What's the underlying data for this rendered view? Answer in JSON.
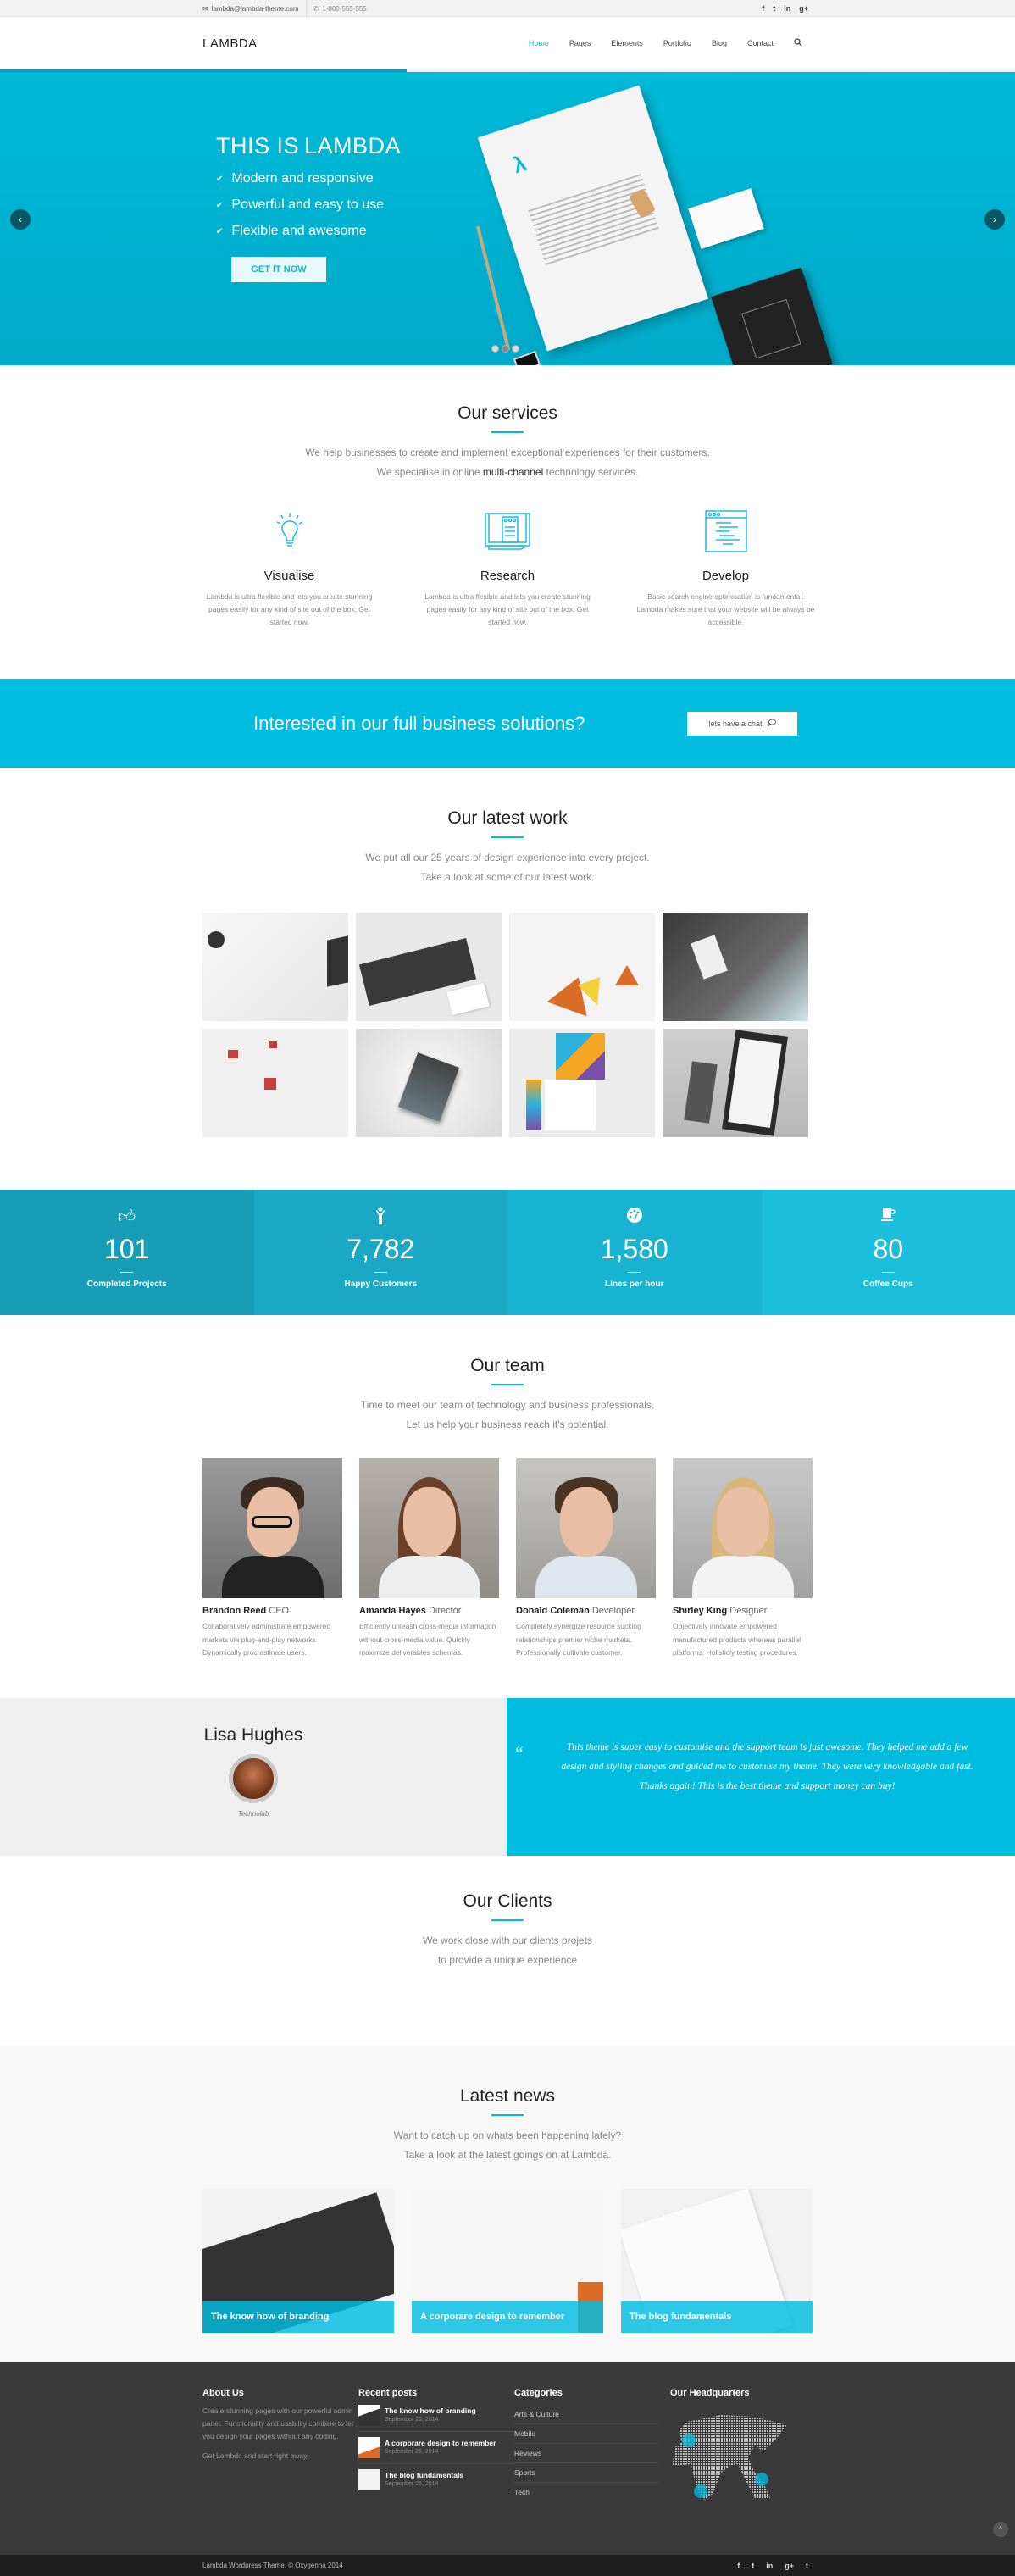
{
  "topbar": {
    "email": "lambda@lambda-theme.com",
    "phone": "1-800-555-555",
    "social": [
      "f",
      "t",
      "in",
      "g+"
    ]
  },
  "header": {
    "logo": "LAMBDA",
    "nav": [
      "Home",
      "Pages",
      "Elements",
      "Portfolio",
      "Blog",
      "Contact"
    ],
    "active_nav": "Home"
  },
  "hero": {
    "title_light": "THIS IS",
    "title_bold": "LAMBDA",
    "features": [
      "Modern and responsive",
      "Powerful and easy to use",
      "Flexible and awesome"
    ],
    "button": "GET IT NOW",
    "slides": 3,
    "active_slide": 2
  },
  "services": {
    "title": "Our services",
    "sub1": "We help businesses to create and implement exceptional experiences for their customers.",
    "sub2_pre": "We specialise in online ",
    "sub2_bold": "multi-channel",
    "sub2_post": " technology services.",
    "items": [
      {
        "icon": "lightbulb-icon",
        "title": "Visualise",
        "text": "Lambda is ultra flexible and lets you create stunning pages easily for any kind of site out of the box. Get started now."
      },
      {
        "icon": "book-notes-icon",
        "title": "Research",
        "text": "Lambda is ultra flexible and lets you create stunning pages easily for any kind of site out of the box. Get started now."
      },
      {
        "icon": "code-window-icon",
        "title": "Develop",
        "text": "Basic search engine optimisation is fundamental. Lambda makes sure that your website will be always be accessible."
      }
    ]
  },
  "cta": {
    "text": "Interested in our full business solutions?",
    "button": "lets have a chat"
  },
  "work": {
    "title": "Our latest work",
    "sub1": "We put all our 25 years of design experience into every project.",
    "sub2": "Take a look at some of our latest work."
  },
  "stats": [
    {
      "icon": "thumbs-up-icon",
      "value": "101",
      "label": "Completed Projects",
      "color": "#179db5"
    },
    {
      "icon": "person-icon",
      "value": "7,782",
      "label": "Happy Customers",
      "color": "#19a9c4"
    },
    {
      "icon": "dashboard-icon",
      "value": "1,580",
      "label": "Lines per hour",
      "color": "#17b3d0"
    },
    {
      "icon": "coffee-cup-icon",
      "value": "80",
      "label": "Coffee Cups",
      "color": "#1bbfdb"
    }
  ],
  "team": {
    "title": "Our team",
    "sub1": "Time to meet our team of technology and business professionals.",
    "sub2": "Let us help your business reach it's potential.",
    "members": [
      {
        "name": "Brandon Reed",
        "role": "CEO",
        "bio": "Collaboratively administrate empowered markets via plug-and-play networks. Dynamically procrastinate users."
      },
      {
        "name": "Amanda Hayes",
        "role": "Director",
        "bio": "Efficiently unleash cross-media information without cross-media value. Quickly maximize deliverables schemas."
      },
      {
        "name": "Donald Coleman",
        "role": "Developer",
        "bio": "Completely synergize resource sucking relationships premier niche markets. Professionally cultivate customer."
      },
      {
        "name": "Shirley King",
        "role": "Designer",
        "bio": "Objectively innovate empowered manufactured products whereas parallel platforms. Holisticly testing procedures."
      }
    ]
  },
  "testimonial": {
    "name": "Lisa Hughes",
    "company": "Technolab",
    "quote": "This theme is super easy to customise and the support team is just awesome. They helped me add a few design and styling changes and guided me to customise my theme. They were very knowledgable and fast. Thanks again! This is the best theme and support money can buy!"
  },
  "clients": {
    "title": "Our Clients",
    "sub1": "We work close with our clients projets",
    "sub2": "to provide a unique experience"
  },
  "news": {
    "title": "Latest news",
    "sub1": "Want to catch up on whats been happening lately?",
    "sub2": "Take a look at the latest goings on at Lambda.",
    "posts": [
      "The know how of branding",
      "A corporare design to remember",
      "The blog fundamentals"
    ]
  },
  "footer": {
    "about_title": "About Us",
    "about_text": "Create stunning pages with our powerful admin panel. Functionality and usability combine to let you design your pages without any coding.",
    "about_text2": "Get Lambda and start right away.",
    "recent_title": "Recent posts",
    "recent": [
      {
        "title": "The know how of branding",
        "date": "September 25, 2014"
      },
      {
        "title": "A corporare design to remember",
        "date": "September 25, 2014"
      },
      {
        "title": "The blog fundamentals",
        "date": "September 25, 2014"
      }
    ],
    "categories_title": "Categories",
    "categories": [
      "Arts & Culture",
      "Mobile",
      "Reviews",
      "Sports",
      "Tech"
    ],
    "hq_title": "Our Headquarters",
    "copyright": "Lambda Wordpress Theme. © Oxygenna 2014",
    "social": [
      "f",
      "t",
      "in",
      "g+",
      "t"
    ]
  },
  "colors": {
    "accent": "#00bde0",
    "footer": "#3a3a3a",
    "bottombar": "#1e1e1e"
  }
}
